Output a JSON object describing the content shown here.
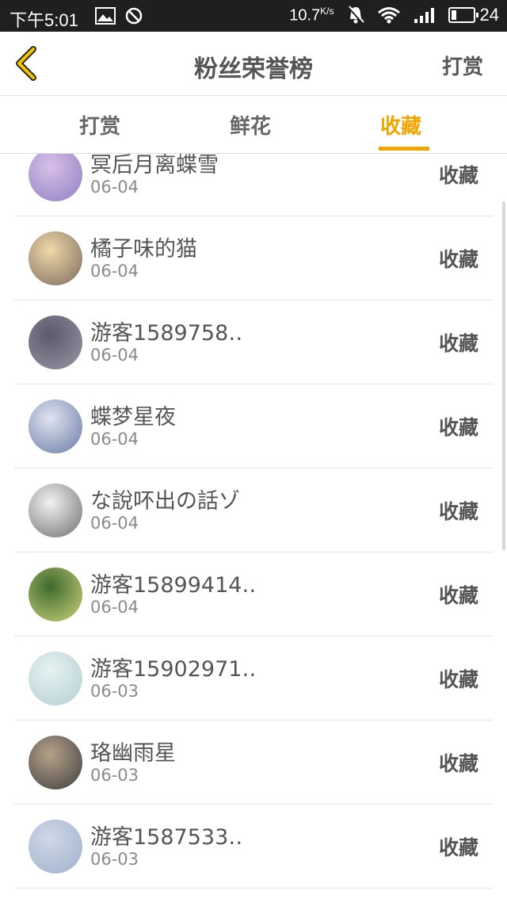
{
  "status_bar": {
    "time": "下午5:01",
    "speed": "10.7",
    "speed_unit": "K/s",
    "battery": "24"
  },
  "header": {
    "title": "粉丝荣誉榜",
    "action": "打赏"
  },
  "tabs": [
    {
      "label": "打赏",
      "active": false
    },
    {
      "label": "鲜花",
      "active": false
    },
    {
      "label": "收藏",
      "active": true
    }
  ],
  "rows": [
    {
      "name": "冥后月离蝶雪",
      "date": "06-04",
      "action": "收藏",
      "avatar_colors": [
        "#d8c0e8",
        "#8e7fc2"
      ]
    },
    {
      "name": "橘子味的猫",
      "date": "06-04",
      "action": "收藏",
      "avatar_colors": [
        "#f0d8a8",
        "#7a6a5e"
      ]
    },
    {
      "name": "游客1589758‥",
      "date": "06-04",
      "action": "收藏",
      "avatar_colors": [
        "#5a5a6a",
        "#9a96a6"
      ]
    },
    {
      "name": "蝶梦星夜",
      "date": "06-04",
      "action": "收藏",
      "avatar_colors": [
        "#dfe4f0",
        "#6a7aa6"
      ]
    },
    {
      "name": "な說吥出の話ゾ",
      "date": "06-04",
      "action": "收藏",
      "avatar_colors": [
        "#f2f2f2",
        "#6f6f6f"
      ]
    },
    {
      "name": "游客15899414‥",
      "date": "06-04",
      "action": "收藏",
      "avatar_colors": [
        "#3f6a2e",
        "#c9d27a"
      ]
    },
    {
      "name": "游客15902971‥",
      "date": "06-03",
      "action": "收藏",
      "avatar_colors": [
        "#e6f2f2",
        "#b4cfd2"
      ]
    },
    {
      "name": "珞幽雨星",
      "date": "06-03",
      "action": "收藏",
      "avatar_colors": [
        "#b6a18a",
        "#3f3f3f"
      ]
    },
    {
      "name": "游客1587533‥",
      "date": "06-03",
      "action": "收藏",
      "avatar_colors": [
        "#cfd8e6",
        "#9fb1cc"
      ]
    }
  ],
  "colors": {
    "accent": "#f0a500",
    "text": "#555555",
    "subtext": "#8a8a8a"
  }
}
